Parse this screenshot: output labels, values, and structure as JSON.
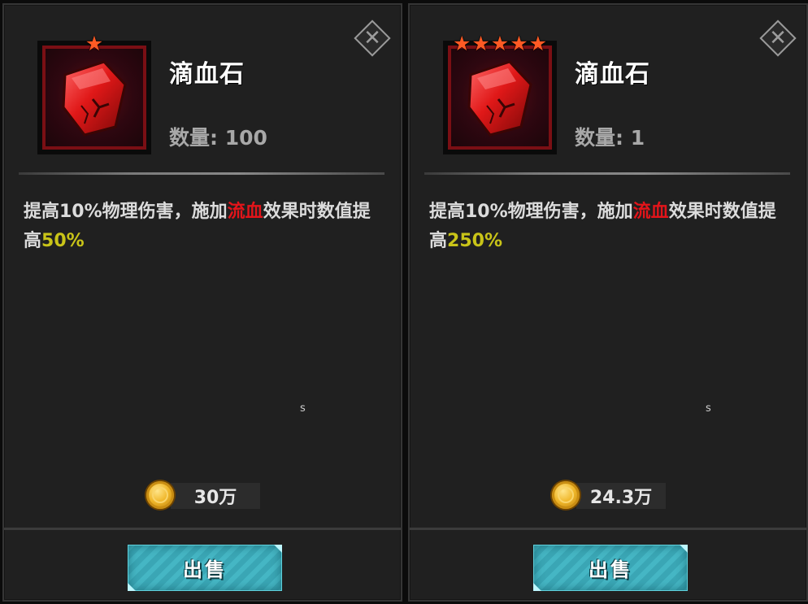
{
  "panels": [
    {
      "name": "滴血石",
      "stars": 1,
      "quantity": "数量: 100",
      "desc_prefix": "提高10%物理伤害，施加",
      "desc_highlight_red": "流血",
      "desc_middle": "效果时数值提高",
      "desc_highlight_yellow": "50%",
      "stray_char": "s",
      "price": "30万",
      "sell_label": "出售"
    },
    {
      "name": "滴血石",
      "stars": 5,
      "quantity": "数量: 1",
      "desc_prefix": "提高10%物理伤害，施加",
      "desc_highlight_red": "流血",
      "desc_middle": "效果时数值提高",
      "desc_highlight_yellow": "250%",
      "stray_char": "s",
      "price": "24.3万",
      "sell_label": "出售"
    }
  ],
  "icons": {
    "close": "close-icon",
    "star": "star-icon",
    "item": "blood-stone-icon",
    "coin": "gold-coin-icon"
  },
  "colors": {
    "star": "#ff5a24",
    "highlight_red": "#e3141a",
    "highlight_yellow": "#c9c418",
    "sell_button": "#3fb0bf"
  }
}
